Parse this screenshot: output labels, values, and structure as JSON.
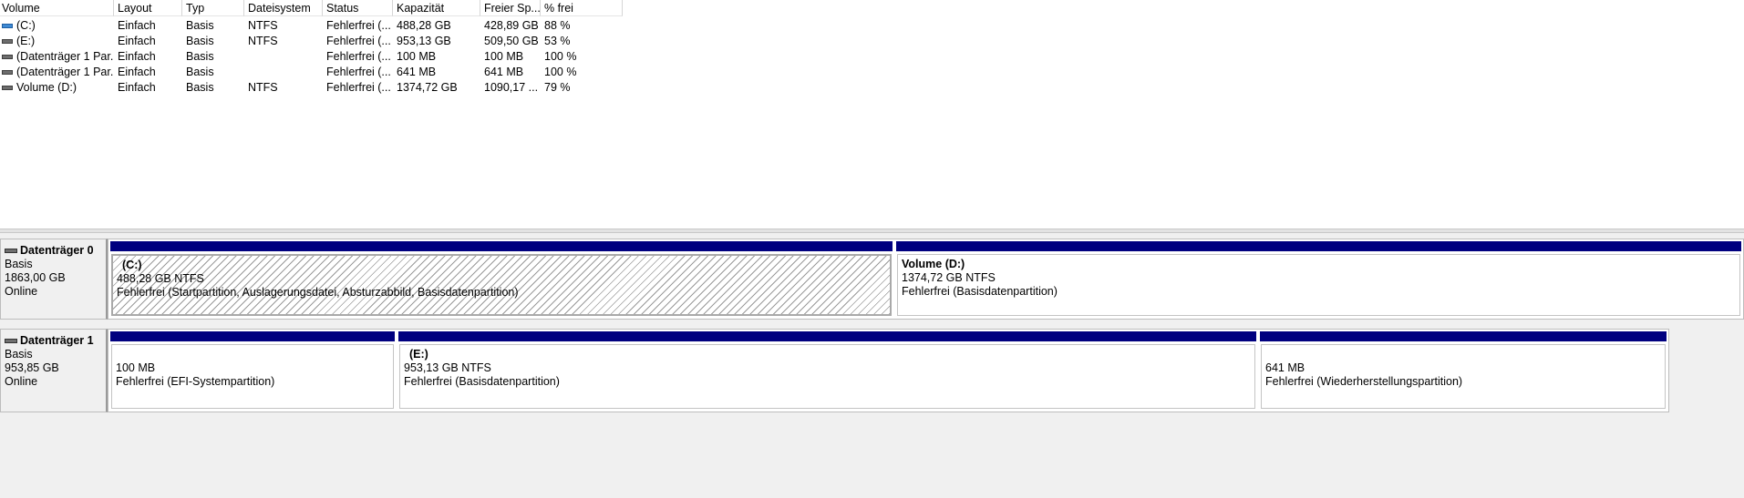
{
  "columns": [
    "Volume",
    "Layout",
    "Typ",
    "Dateisystem",
    "Status",
    "Kapazität",
    "Freier Sp...",
    "% frei"
  ],
  "volumes": [
    {
      "icon": "system-drive-icon",
      "volume": "(C:)",
      "layout": "Einfach",
      "typ": "Basis",
      "fs": "NTFS",
      "status": "Fehlerfrei (...",
      "capacity": "488,28 GB",
      "free": "428,89 GB",
      "pct": "88 %"
    },
    {
      "icon": "drive-icon",
      "volume": "(E:)",
      "layout": "Einfach",
      "typ": "Basis",
      "fs": "NTFS",
      "status": "Fehlerfrei (...",
      "capacity": "953,13 GB",
      "free": "509,50 GB",
      "pct": "53 %"
    },
    {
      "icon": "drive-icon",
      "volume": "(Datenträger 1 Par...",
      "layout": "Einfach",
      "typ": "Basis",
      "fs": "",
      "status": "Fehlerfrei (...",
      "capacity": "100 MB",
      "free": "100 MB",
      "pct": "100 %"
    },
    {
      "icon": "drive-icon",
      "volume": "(Datenträger 1 Par...",
      "layout": "Einfach",
      "typ": "Basis",
      "fs": "",
      "status": "Fehlerfrei (...",
      "capacity": "641 MB",
      "free": "641 MB",
      "pct": "100 %"
    },
    {
      "icon": "drive-icon",
      "volume": "Volume (D:)",
      "layout": "Einfach",
      "typ": "Basis",
      "fs": "NTFS",
      "status": "Fehlerfrei (...",
      "capacity": "1374,72 GB",
      "free": "1090,17 ...",
      "pct": "79 %"
    }
  ],
  "disks": [
    {
      "name": "Datenträger 0",
      "type": "Basis",
      "size": "1863,00 GB",
      "state": "Online",
      "partitions": [
        {
          "title": "(C:)",
          "size": "488,28 GB NTFS",
          "status": "Fehlerfrei (Startpartition, Auslagerungsdatei, Absturzabbild, Basisdatenpartition)"
        },
        {
          "title": "Volume  (D:)",
          "size": "1374,72 GB NTFS",
          "status": "Fehlerfrei (Basisdatenpartition)"
        }
      ]
    },
    {
      "name": "Datenträger 1",
      "type": "Basis",
      "size": "953,85 GB",
      "state": "Online",
      "partitions": [
        {
          "title": "",
          "size": "100 MB",
          "status": "Fehlerfrei (EFI-Systempartition)"
        },
        {
          "title": "(E:)",
          "size": "953,13 GB NTFS",
          "status": "Fehlerfrei (Basisdatenpartition)"
        },
        {
          "title": "",
          "size": "641 MB",
          "status": "Fehlerfrei (Wiederherstellungspartition)"
        }
      ]
    }
  ],
  "colors": {
    "partition_bar": "#00007f",
    "system_drive": "#3f8ad3"
  }
}
